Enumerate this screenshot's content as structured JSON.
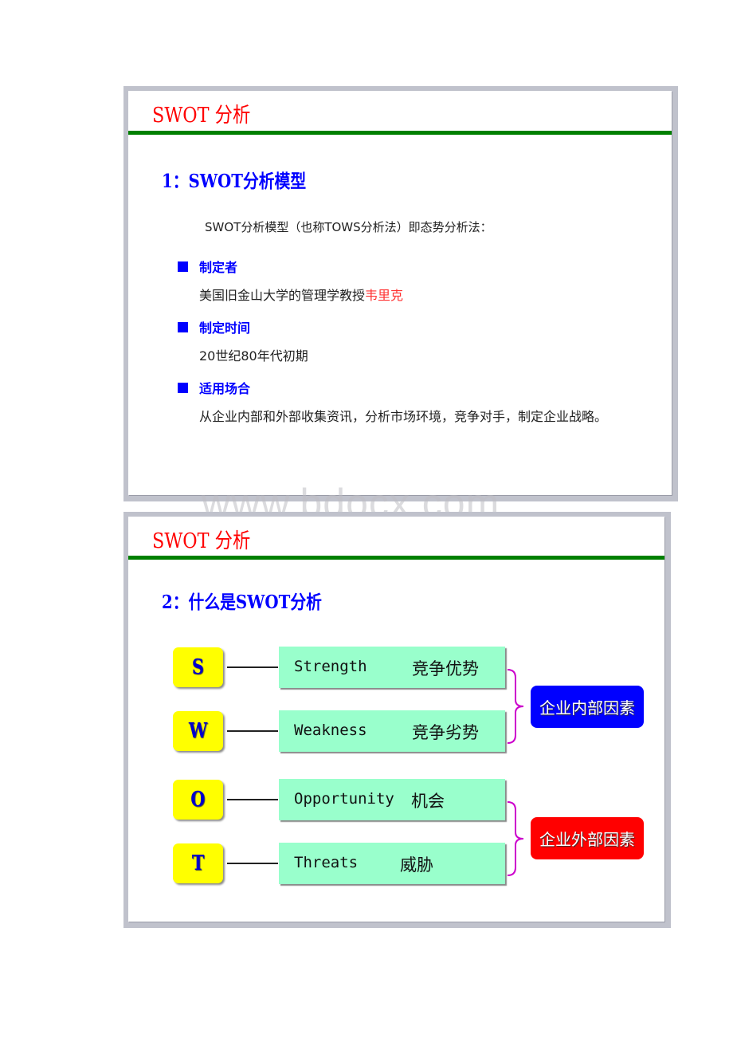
{
  "watermark": "www.bdocx.com",
  "slides": [
    {
      "title": "SWOT 分析",
      "heading": "1：SWOT分析模型",
      "intro": "SWOT分析模型（也称TOWS分析法）即态势分析法：",
      "bullets": [
        {
          "label": "制定者",
          "body": "美国旧金山大学的管理学教授",
          "highlight": "韦里克"
        },
        {
          "label": "制定时间",
          "body": "20世纪80年代初期"
        },
        {
          "label": "适用场合",
          "body": "从企业内部和外部收集资讯，分析市场环境，竞争对手，制定企业战略。"
        }
      ]
    },
    {
      "title": "SWOT 分析",
      "heading": "2：什么是SWOT分析",
      "items": [
        {
          "letter": "S",
          "english": "Strength",
          "chinese": "竞争优势"
        },
        {
          "letter": "W",
          "english": "Weakness",
          "chinese": "竞争劣势"
        },
        {
          "letter": "O",
          "english": "Opportunity",
          "chinese": "机会"
        },
        {
          "letter": "T",
          "english": "Threats",
          "chinese": "威胁"
        }
      ],
      "groups": [
        {
          "label": "企业内部因素",
          "color": "#0000ff"
        },
        {
          "label": "企业外部因素",
          "color": "#ff0000"
        }
      ],
      "colors": {
        "letter_box": "#ffff00",
        "item_box": "#99ffcc",
        "brace": "#cc00cc",
        "rule": "#008000"
      }
    }
  ]
}
